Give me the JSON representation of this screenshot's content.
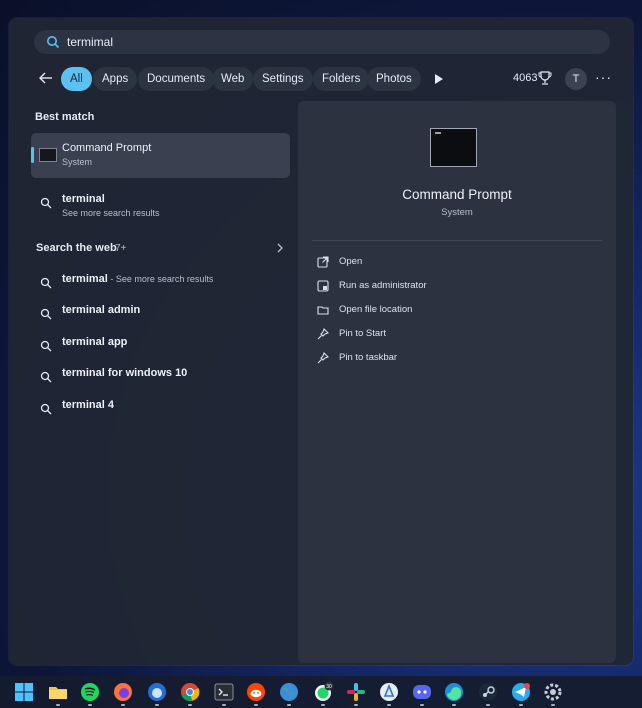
{
  "search": {
    "query": "termimal"
  },
  "filters": {
    "tabs": [
      "All",
      "Apps",
      "Documents",
      "Web",
      "Settings",
      "Folders",
      "Photos"
    ],
    "points": "4063",
    "avatar_letter": "T",
    "more_label": "···"
  },
  "best_match": {
    "heading": "Best match",
    "title": "Command Prompt",
    "subtitle": "System"
  },
  "secondary_result": {
    "title": "terminal",
    "subtitle": "See more search results"
  },
  "web": {
    "heading": "Search the web",
    "count": "7+",
    "results": [
      {
        "text": "termimal",
        "extra": " - See more search results"
      },
      {
        "text": "terminal admin",
        "extra": ""
      },
      {
        "text": "terminal app",
        "extra": ""
      },
      {
        "text": "terminal for windows 10",
        "extra": ""
      },
      {
        "text": "terminal 4",
        "extra": ""
      }
    ]
  },
  "preview": {
    "title": "Command Prompt",
    "subtitle": "System",
    "actions": [
      "Open",
      "Run as administrator",
      "Open file location",
      "Pin to Start",
      "Pin to taskbar"
    ]
  },
  "taskbar": {
    "icons": [
      "windows-start",
      "file-explorer",
      "spotify",
      "firefox",
      "thunderbird",
      "chrome",
      "terminal",
      "reddit",
      "earth",
      "whatsapp",
      "slack",
      "app-store",
      "discord",
      "edge",
      "steam",
      "telegram",
      "settings"
    ],
    "whatsapp_badge": "30"
  },
  "colors": {
    "accent": "#5cc1f0",
    "panel": "#202634",
    "chip": "#2c3341"
  }
}
